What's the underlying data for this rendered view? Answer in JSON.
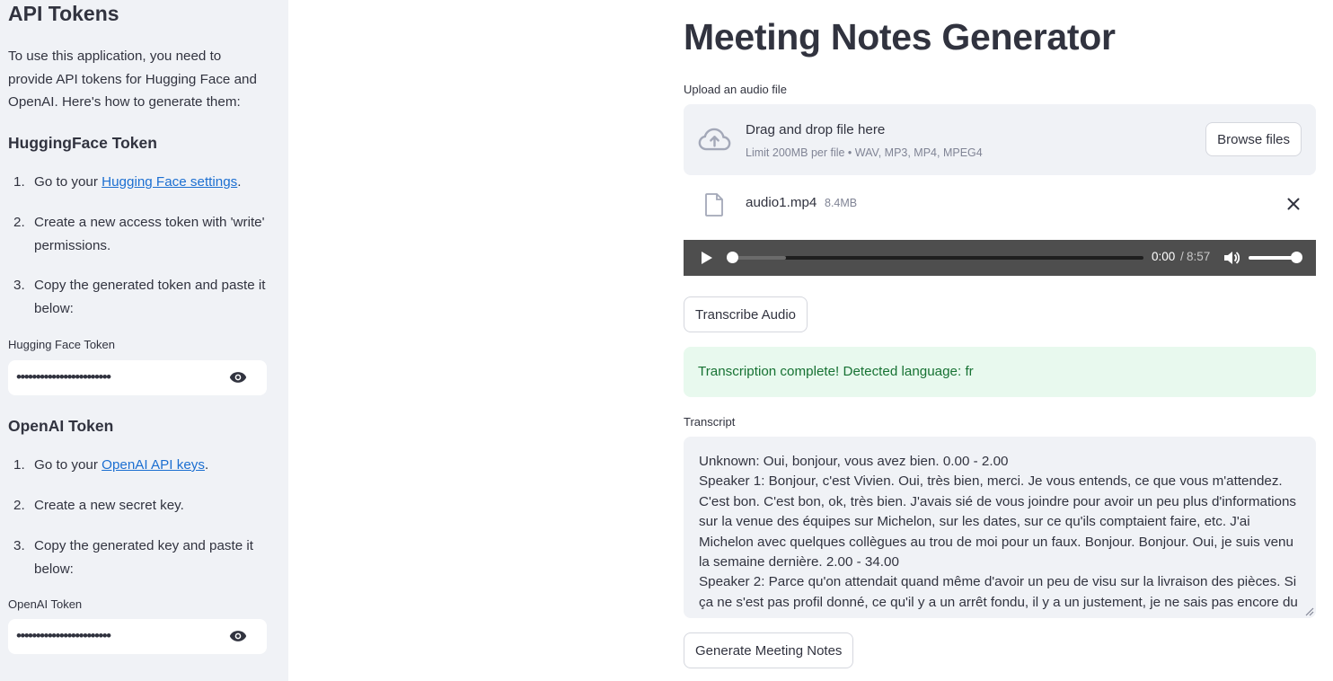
{
  "sidebar": {
    "title": "API Tokens",
    "intro": "To use this application, you need to provide API tokens for Hugging Face and OpenAI. Here's how to generate them:",
    "hf": {
      "heading": "HuggingFace Token",
      "steps": [
        {
          "num": "1.",
          "pre": "Go to your ",
          "link": "Hugging Face settings",
          "post": "."
        },
        {
          "num": "2.",
          "text": "Create a new access token with 'write' permissions."
        },
        {
          "num": "3.",
          "text": "Copy the generated token and paste it below:"
        }
      ],
      "field_label": "Hugging Face Token",
      "field_value": "••••••••••••••••••••••••"
    },
    "openai": {
      "heading": "OpenAI Token",
      "steps": [
        {
          "num": "1.",
          "pre": "Go to your ",
          "link": "OpenAI API keys",
          "post": "."
        },
        {
          "num": "2.",
          "text": "Create a new secret key."
        },
        {
          "num": "3.",
          "text": "Copy the generated key and paste it below:"
        }
      ],
      "field_label": "OpenAI Token",
      "field_value": "••••••••••••••••••••••••"
    }
  },
  "main": {
    "title": "Meeting Notes Generator",
    "upload": {
      "label": "Upload an audio file",
      "drop_text": "Drag and drop file here",
      "limit_text": "Limit 200MB per file • WAV, MP3, MP4, MPEG4",
      "browse_label": "Browse files"
    },
    "file": {
      "name": "audio1.mp4",
      "size": "8.4MB"
    },
    "audio": {
      "current": "0:00",
      "separator": "/",
      "duration": "8:57",
      "progress": 0.0,
      "buffered": 0.13,
      "volume": 1.0
    },
    "transcribe_label": "Transcribe Audio",
    "success_text": "Transcription complete! Detected language: fr",
    "transcript": {
      "label": "Transcript",
      "text": "Unknown: Oui, bonjour, vous avez bien. 0.00 - 2.00\nSpeaker 1: Bonjour, c'est Vivien. Oui, très bien, merci. Je vous entends, ce que vous m'attendez. C'est bon. C'est bon, ok, très bien. J'avais sié de vous joindre pour avoir un peu plus d'informations sur la venue des équipes sur Michelon, sur les dates, sur ce qu'ils comptaient faire, etc. J'ai Michelon avec quelques collègues au trou de moi pour un faux. Bonjour. Bonjour. Oui, je suis venu la semaine dernière. 2.00 - 34.00\nSpeaker 2: Parce qu'on attendait quand même d'avoir un peu de visu sur la livraison des pièces. Si ça ne s'est pas profil donné, ce qu'il y a un arrêt fondu, il y a un justement, je ne sais pas encore du"
    },
    "generate_label": "Generate Meeting Notes"
  },
  "colors": {
    "sidebar_bg": "#f0f2f6",
    "text": "#31333f",
    "link": "#1c6fd1",
    "success_bg": "#e8f9ee",
    "success_text": "#177233",
    "audio_bg": "#4e4e4e"
  }
}
